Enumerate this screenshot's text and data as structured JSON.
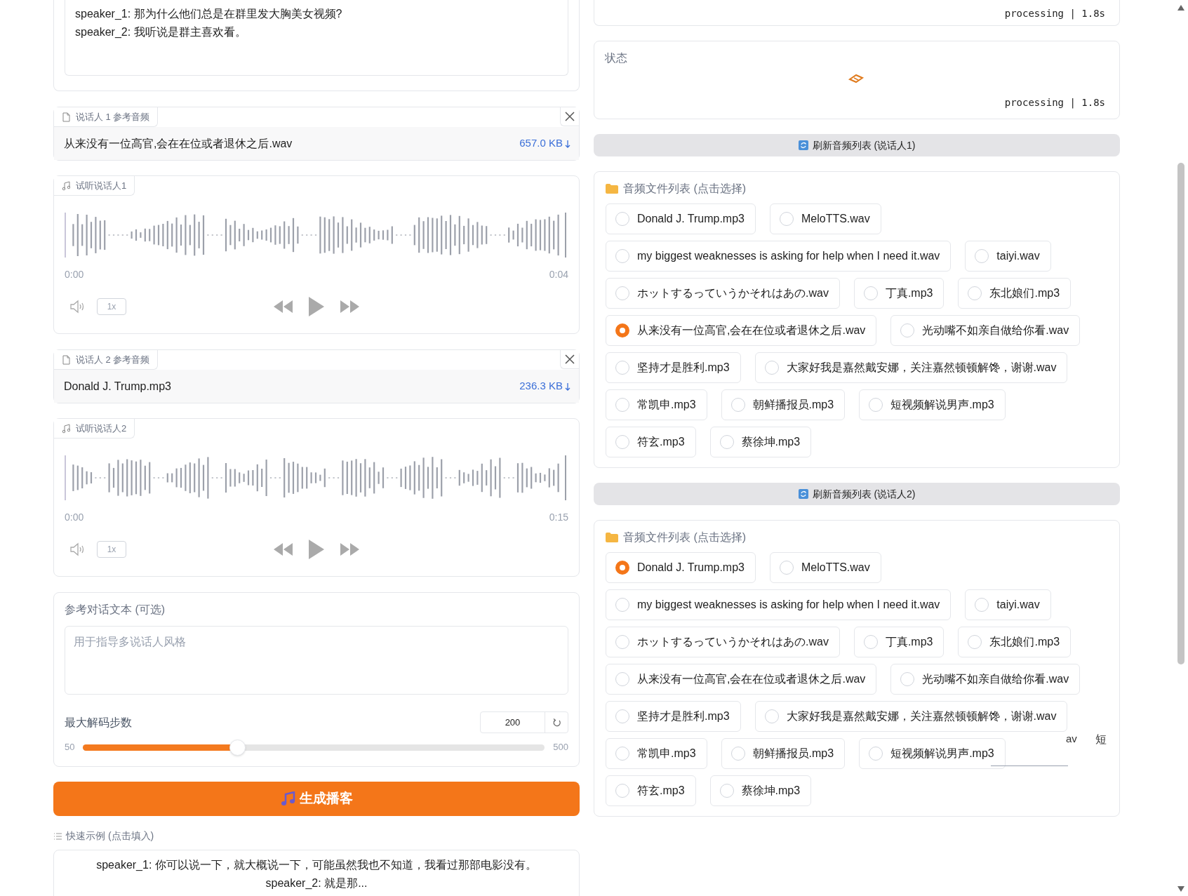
{
  "dialogue_box": {
    "lines": [
      "speaker_1: 那为什么他们总是在群里发大胸美女视频?",
      "speaker_2: 我听说是群主喜欢看。"
    ]
  },
  "speakers": [
    {
      "file": {
        "label": "说话人 1 参考音频",
        "filename": "从来没有一位高官,会在在位或者退休之后.wav",
        "size": "657.0 KB"
      },
      "player": {
        "label": "试听说话人1",
        "start": "0:00",
        "end": "0:04",
        "speed": "1x"
      }
    },
    {
      "file": {
        "label": "说话人 2 参考音频",
        "filename": "Donald J. Trump.mp3",
        "size": "236.3 KB"
      },
      "player": {
        "label": "试听说话人2",
        "start": "0:00",
        "end": "0:15",
        "speed": "1x"
      }
    }
  ],
  "reference_text": {
    "label": "参考对话文本 (可选)",
    "placeholder": "用于指导多说话人风格"
  },
  "max_steps": {
    "label": "最大解码步数",
    "value": "200",
    "min": "50",
    "max": "500",
    "level": 0.333
  },
  "generate_button": {
    "label": "生成播客"
  },
  "examples": {
    "label": "快速示例 (点击填入)",
    "items": [
      {
        "lines": [
          "speaker_1: 你可以说一下，就大概说一下，可能虽然我也不知道，我看过那部电影没有。",
          "speaker_2: 就是那..."
        ]
      }
    ]
  },
  "top_output": {
    "timer": "processing | 1.8s"
  },
  "status": {
    "label": "状态",
    "timer": "processing | 1.8s"
  },
  "file_lists": [
    {
      "refresh_button": "刷新音频列表 (说话人1)",
      "title": "音频文件列表 (点击选择)",
      "options": [
        {
          "label": "Donald J. Trump.mp3",
          "selected": false
        },
        {
          "label": "MeloTTS.wav",
          "selected": false
        },
        {
          "label": "my biggest weaknesses is asking for help when I need it.wav",
          "selected": false
        },
        {
          "label": "taiyi.wav",
          "selected": false
        },
        {
          "label": "ホットするっていうかそれはあの.wav",
          "selected": false
        },
        {
          "label": "丁真.mp3",
          "selected": false
        },
        {
          "label": "东北娘们.mp3",
          "selected": false
        },
        {
          "label": "从来没有一位高官,会在在位或者退休之后.wav",
          "selected": true
        },
        {
          "label": "光动嘴不如亲自做给你看.wav",
          "selected": false
        },
        {
          "label": "坚持才是胜利.mp3",
          "selected": false
        },
        {
          "label": "大家好我是嘉然戴安娜，关注嘉然顿顿解馋，谢谢.wav",
          "selected": false
        },
        {
          "label": "常凯申.mp3",
          "selected": false
        },
        {
          "label": "朝鲜播报员.mp3",
          "selected": false
        },
        {
          "label": "短视频解说男声.mp3",
          "selected": false
        },
        {
          "label": "符玄.mp3",
          "selected": false
        },
        {
          "label": "蔡徐坤.mp3",
          "selected": false
        }
      ]
    },
    {
      "refresh_button": "刷新音频列表 (说话人2)",
      "title": "音频文件列表 (点击选择)",
      "options": [
        {
          "label": "Donald J. Trump.mp3",
          "selected": true
        },
        {
          "label": "MeloTTS.wav",
          "selected": false
        },
        {
          "label": "my biggest weaknesses is asking for help when I need it.wav",
          "selected": false
        },
        {
          "label": "taiyi.wav",
          "selected": false
        },
        {
          "label": "ホットするっていうかそれはあの.wav",
          "selected": false
        },
        {
          "label": "丁真.mp3",
          "selected": false
        },
        {
          "label": "东北娘们.mp3",
          "selected": false
        },
        {
          "label": "从来没有一位高官,会在在位或者退休之后.wav",
          "selected": false
        },
        {
          "label": "光动嘴不如亲自做给你看.wav",
          "selected": false
        },
        {
          "label": "坚持才是胜利.mp3",
          "selected": false
        },
        {
          "label": "大家好我是嘉然戴安娜，关注嘉然顿顿解馋，谢谢.wav",
          "selected": false
        },
        {
          "label": "常凯申.mp3",
          "selected": false
        },
        {
          "label": "朝鲜播报员.mp3",
          "selected": false
        },
        {
          "label": "短视频解说男声.mp3",
          "selected": false
        },
        {
          "label": "符玄.mp3",
          "selected": false
        },
        {
          "label": "蔡徐坤.mp3",
          "selected": false
        }
      ]
    }
  ],
  "stray_texts": [
    "av",
    "短"
  ]
}
